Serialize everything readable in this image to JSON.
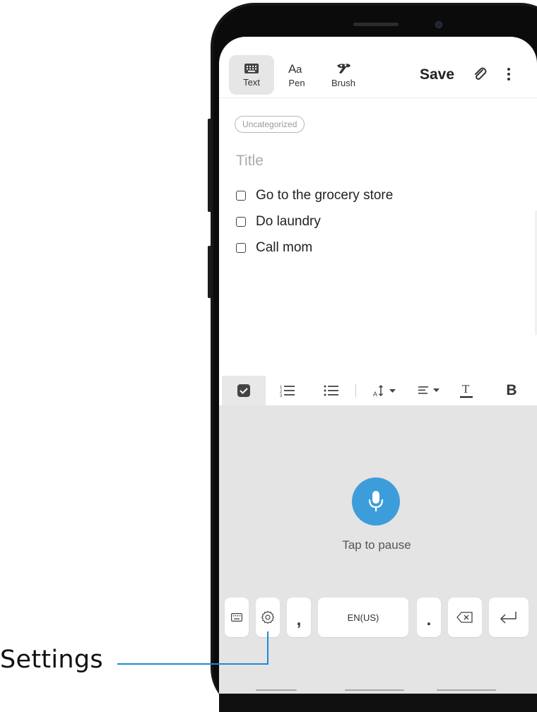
{
  "toolbar": {
    "modes": [
      {
        "label": "Text",
        "icon": "keyboard-icon",
        "active": true
      },
      {
        "label": "Pen",
        "icon": "pen-icon",
        "active": false
      },
      {
        "label": "Brush",
        "icon": "brush-icon",
        "active": false
      }
    ],
    "save_label": "Save",
    "attach_icon": "paperclip-icon",
    "more_icon": "more-vertical-icon"
  },
  "note": {
    "category": "Uncategorized",
    "title_placeholder": "Title",
    "checklist": [
      {
        "text": "Go to the grocery store",
        "checked": false
      },
      {
        "text": "Do laundry",
        "checked": false
      },
      {
        "text": "Call mom",
        "checked": false
      }
    ]
  },
  "format_bar": {
    "items": [
      "checkbox-icon",
      "numbered-list-icon",
      "bullet-list-icon",
      "font-size-icon",
      "align-icon",
      "text-color-icon",
      "bold-icon"
    ],
    "active": "checkbox-icon",
    "bold_label": "B"
  },
  "voice": {
    "status_text": "Tap to pause",
    "keys": {
      "keyboard_icon": "keyboard-icon",
      "settings_icon": "gear-icon",
      "comma": ",",
      "language": "EN(US)",
      "period": ".",
      "backspace_icon": "backspace-icon",
      "enter_icon": "enter-icon"
    }
  },
  "callout": {
    "label": "Settings"
  },
  "colors": {
    "accent": "#3d9ddb",
    "callout_line": "#1d8bd6",
    "panel_bg": "#e4e4e4"
  }
}
